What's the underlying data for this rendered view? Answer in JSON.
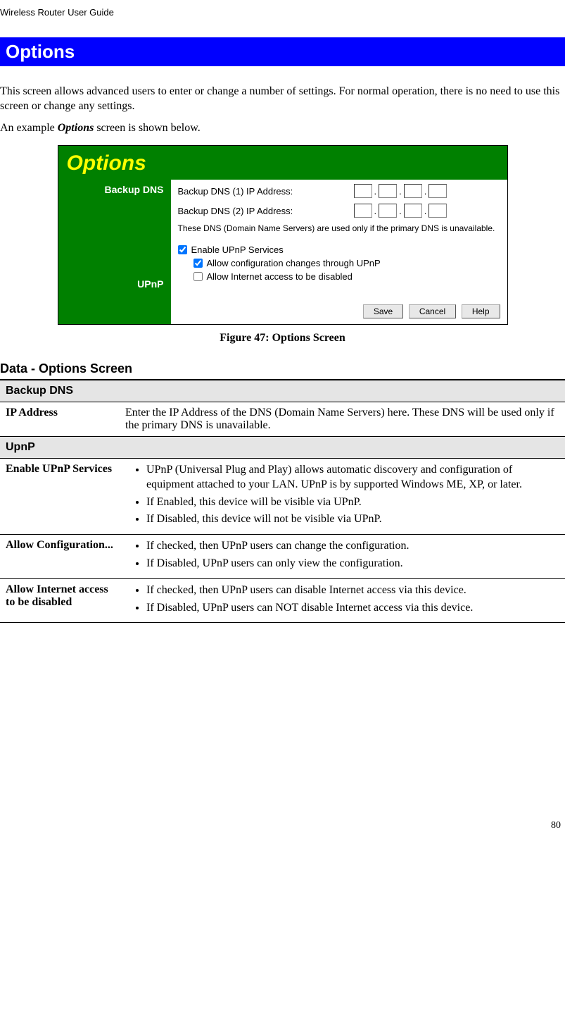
{
  "header": "Wireless Router User Guide",
  "section_title": "Options",
  "intro1": "This screen allows advanced users to enter or change a number of settings. For normal operation, there is no need to use this screen or change any settings.",
  "intro2_prefix": "An example ",
  "intro2_em": "Options",
  "intro2_suffix": " screen is shown below.",
  "panel": {
    "title": "Options",
    "label_backup_dns": "Backup DNS",
    "label_upnp": "UPnP",
    "dns1_text": "Backup DNS (1) IP Address:",
    "dns2_text": "Backup DNS (2) IP Address:",
    "dns_note": "These DNS (Domain Name Servers) are used only if the primary DNS is unavailable.",
    "chk_enable": "Enable UPnP Services",
    "chk_allow_config": "Allow configuration changes through UPnP",
    "chk_allow_disable": "Allow Internet access to be disabled",
    "btn_save": "Save",
    "btn_cancel": "Cancel",
    "btn_help": "Help"
  },
  "figure_caption": "Figure 47: Options Screen",
  "data_heading": "Data - Options Screen",
  "table": {
    "section_backup": "Backup DNS",
    "ip_label": "IP Address",
    "ip_desc": "Enter the IP Address of the DNS (Domain Name Servers) here. These DNS will be used only if the primary DNS is unavailable.",
    "section_upnp": "UpnP",
    "enable_label": "Enable UPnP Services",
    "enable_b1": "UPnP (Universal Plug and Play) allows automatic discovery and configuration of equipment attached to your LAN. UPnP is by supported Windows ME, XP, or later.",
    "enable_b2": "If Enabled, this device will be visible via UPnP.",
    "enable_b3": "If Disabled, this device will not be visible via UPnP.",
    "allow_cfg_label": "Allow Configuration...",
    "allow_cfg_b1": "If checked, then UPnP users can change the configuration.",
    "allow_cfg_b2": "If Disabled, UPnP users can only view the configuration.",
    "allow_dis_label": "Allow Internet access to be disabled",
    "allow_dis_b1": "If checked, then UPnP users can disable Internet access via this device.",
    "allow_dis_b2": "If Disabled, UPnP users can NOT disable Internet access via this device."
  },
  "page_number": "80"
}
